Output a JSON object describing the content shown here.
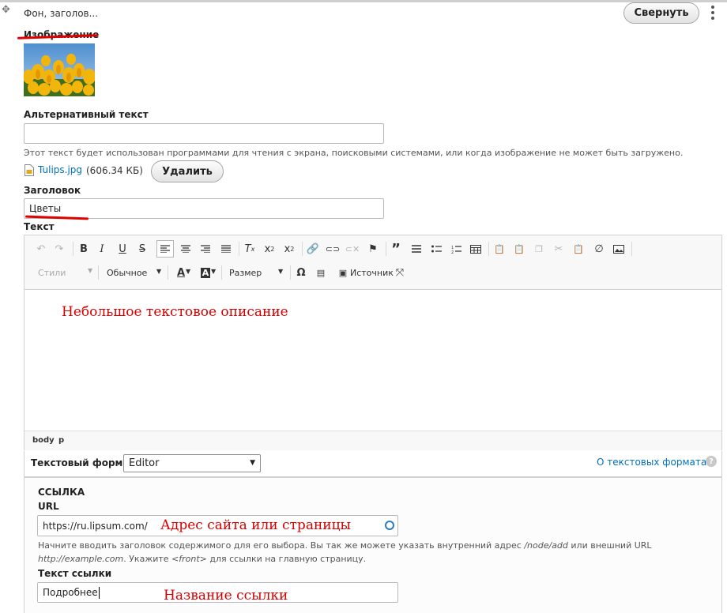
{
  "panel": {
    "title": "Фон, заголов...",
    "collapse_label": "Свернуть"
  },
  "image_field": {
    "label": "Изображение",
    "alt_label": "Альтернативный текст",
    "alt_value": "",
    "alt_description": "Этот текст будет использован программами для чтения с экрана, поисковыми системами, или когда изображение не может быть загружено.",
    "file_name": "Tulips.jpg",
    "file_size": "(606.34 КБ)",
    "delete_label": "Удалить"
  },
  "title_field": {
    "label": "Заголовок",
    "value": "Цветы"
  },
  "text_field": {
    "label": "Текст",
    "toolbar": {
      "styles": "Стили",
      "format": "Обычное",
      "size": "Размер",
      "source": "Источник"
    },
    "content": "Небольшое текстовое описание",
    "path": [
      "body",
      "p"
    ],
    "format_label": "Текстовый формат",
    "format_value": "Editor",
    "formats_link": "О текстовых форматах"
  },
  "link_section": {
    "heading": "ССЫЛКА",
    "url_label": "URL",
    "url_value": "https://ru.lipsum.com/",
    "url_annotation": "Адрес сайта или страницы",
    "help_line1_a": "Начните вводить заголовок содержимого для его выбора. Вы так же можете указать внутренний адрес ",
    "help_line1_em": "/node/add",
    "help_line1_b": " или внешний URL",
    "help_line2_em1": "http://example.com",
    "help_line2_a": ". Укажите ",
    "help_line2_em2": "<front>",
    "help_line2_b": " для ссылки на главную страницу.",
    "text_label": "Текст ссылки",
    "text_value": "Подробнее",
    "text_annotation": "Название ссылки"
  },
  "colors": {
    "accent_link": "#0071b8",
    "annotation_red": "#d40000"
  }
}
